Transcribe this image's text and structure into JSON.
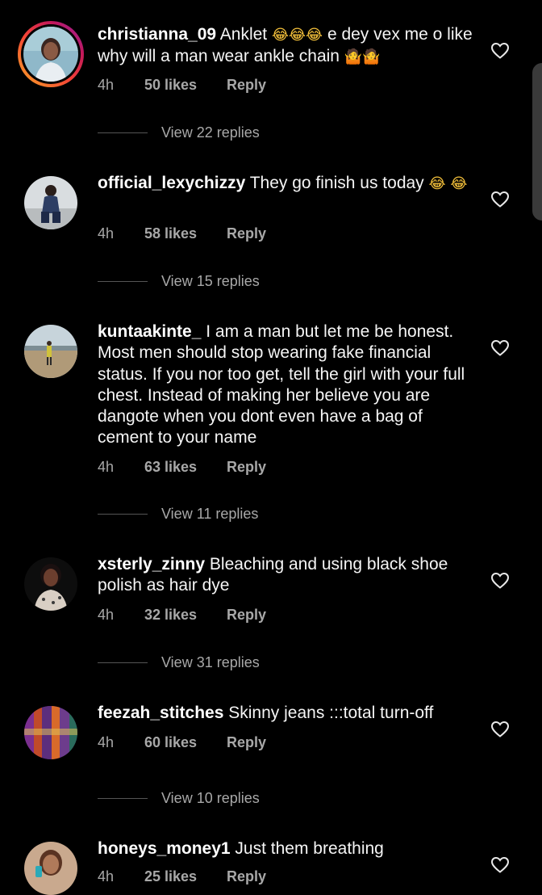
{
  "comments": [
    {
      "username": "christianna_09",
      "text_before": "Anklet",
      "emojis_1": "😂😂😂",
      "text_after": "e dey vex me o like why will a man wear ankle chain",
      "emojis_2": "🤷🤷",
      "time": "4h",
      "likes": "50 likes",
      "reply": "Reply",
      "view_replies": "View 22 replies",
      "like_icon": "heart-outline-icon"
    },
    {
      "username": "official_lexychizzy",
      "text_before": "They go finish us today",
      "emojis_1": "😂",
      "emojis_2": "😂",
      "time": "4h",
      "likes": "58 likes",
      "reply": "Reply",
      "view_replies": "View 15 replies",
      "like_icon": "heart-outline-icon"
    },
    {
      "username": "kuntaakinte_",
      "text": "I am a man but let me be honest. Most men should stop wearing fake financial status. If you nor too get, tell the girl with your full chest. Instead of making her believe you are dangote when you dont even have a bag of cement to your name",
      "time": "4h",
      "likes": "63 likes",
      "reply": "Reply",
      "view_replies": "View 11 replies",
      "like_icon": "heart-outline-icon"
    },
    {
      "username": "xsterly_zinny",
      "text": "Bleaching and using black shoe polish as hair dye",
      "time": "4h",
      "likes": "32 likes",
      "reply": "Reply",
      "view_replies": "View 31 replies",
      "like_icon": "heart-outline-icon"
    },
    {
      "username": "feezah_stitches",
      "text": "Skinny jeans :::total turn-off",
      "time": "4h",
      "likes": "60 likes",
      "reply": "Reply",
      "view_replies": "View 10 replies",
      "like_icon": "heart-outline-icon"
    },
    {
      "username": "honeys_money1",
      "text": "Just them breathing",
      "time": "4h",
      "likes": "25 likes",
      "reply": "Reply",
      "like_icon": "heart-outline-icon"
    }
  ],
  "colors": {
    "background": "#000000",
    "text": "#f5f5f5",
    "secondary_text": "#a8a8a8",
    "story_ring": "#e1306c"
  }
}
